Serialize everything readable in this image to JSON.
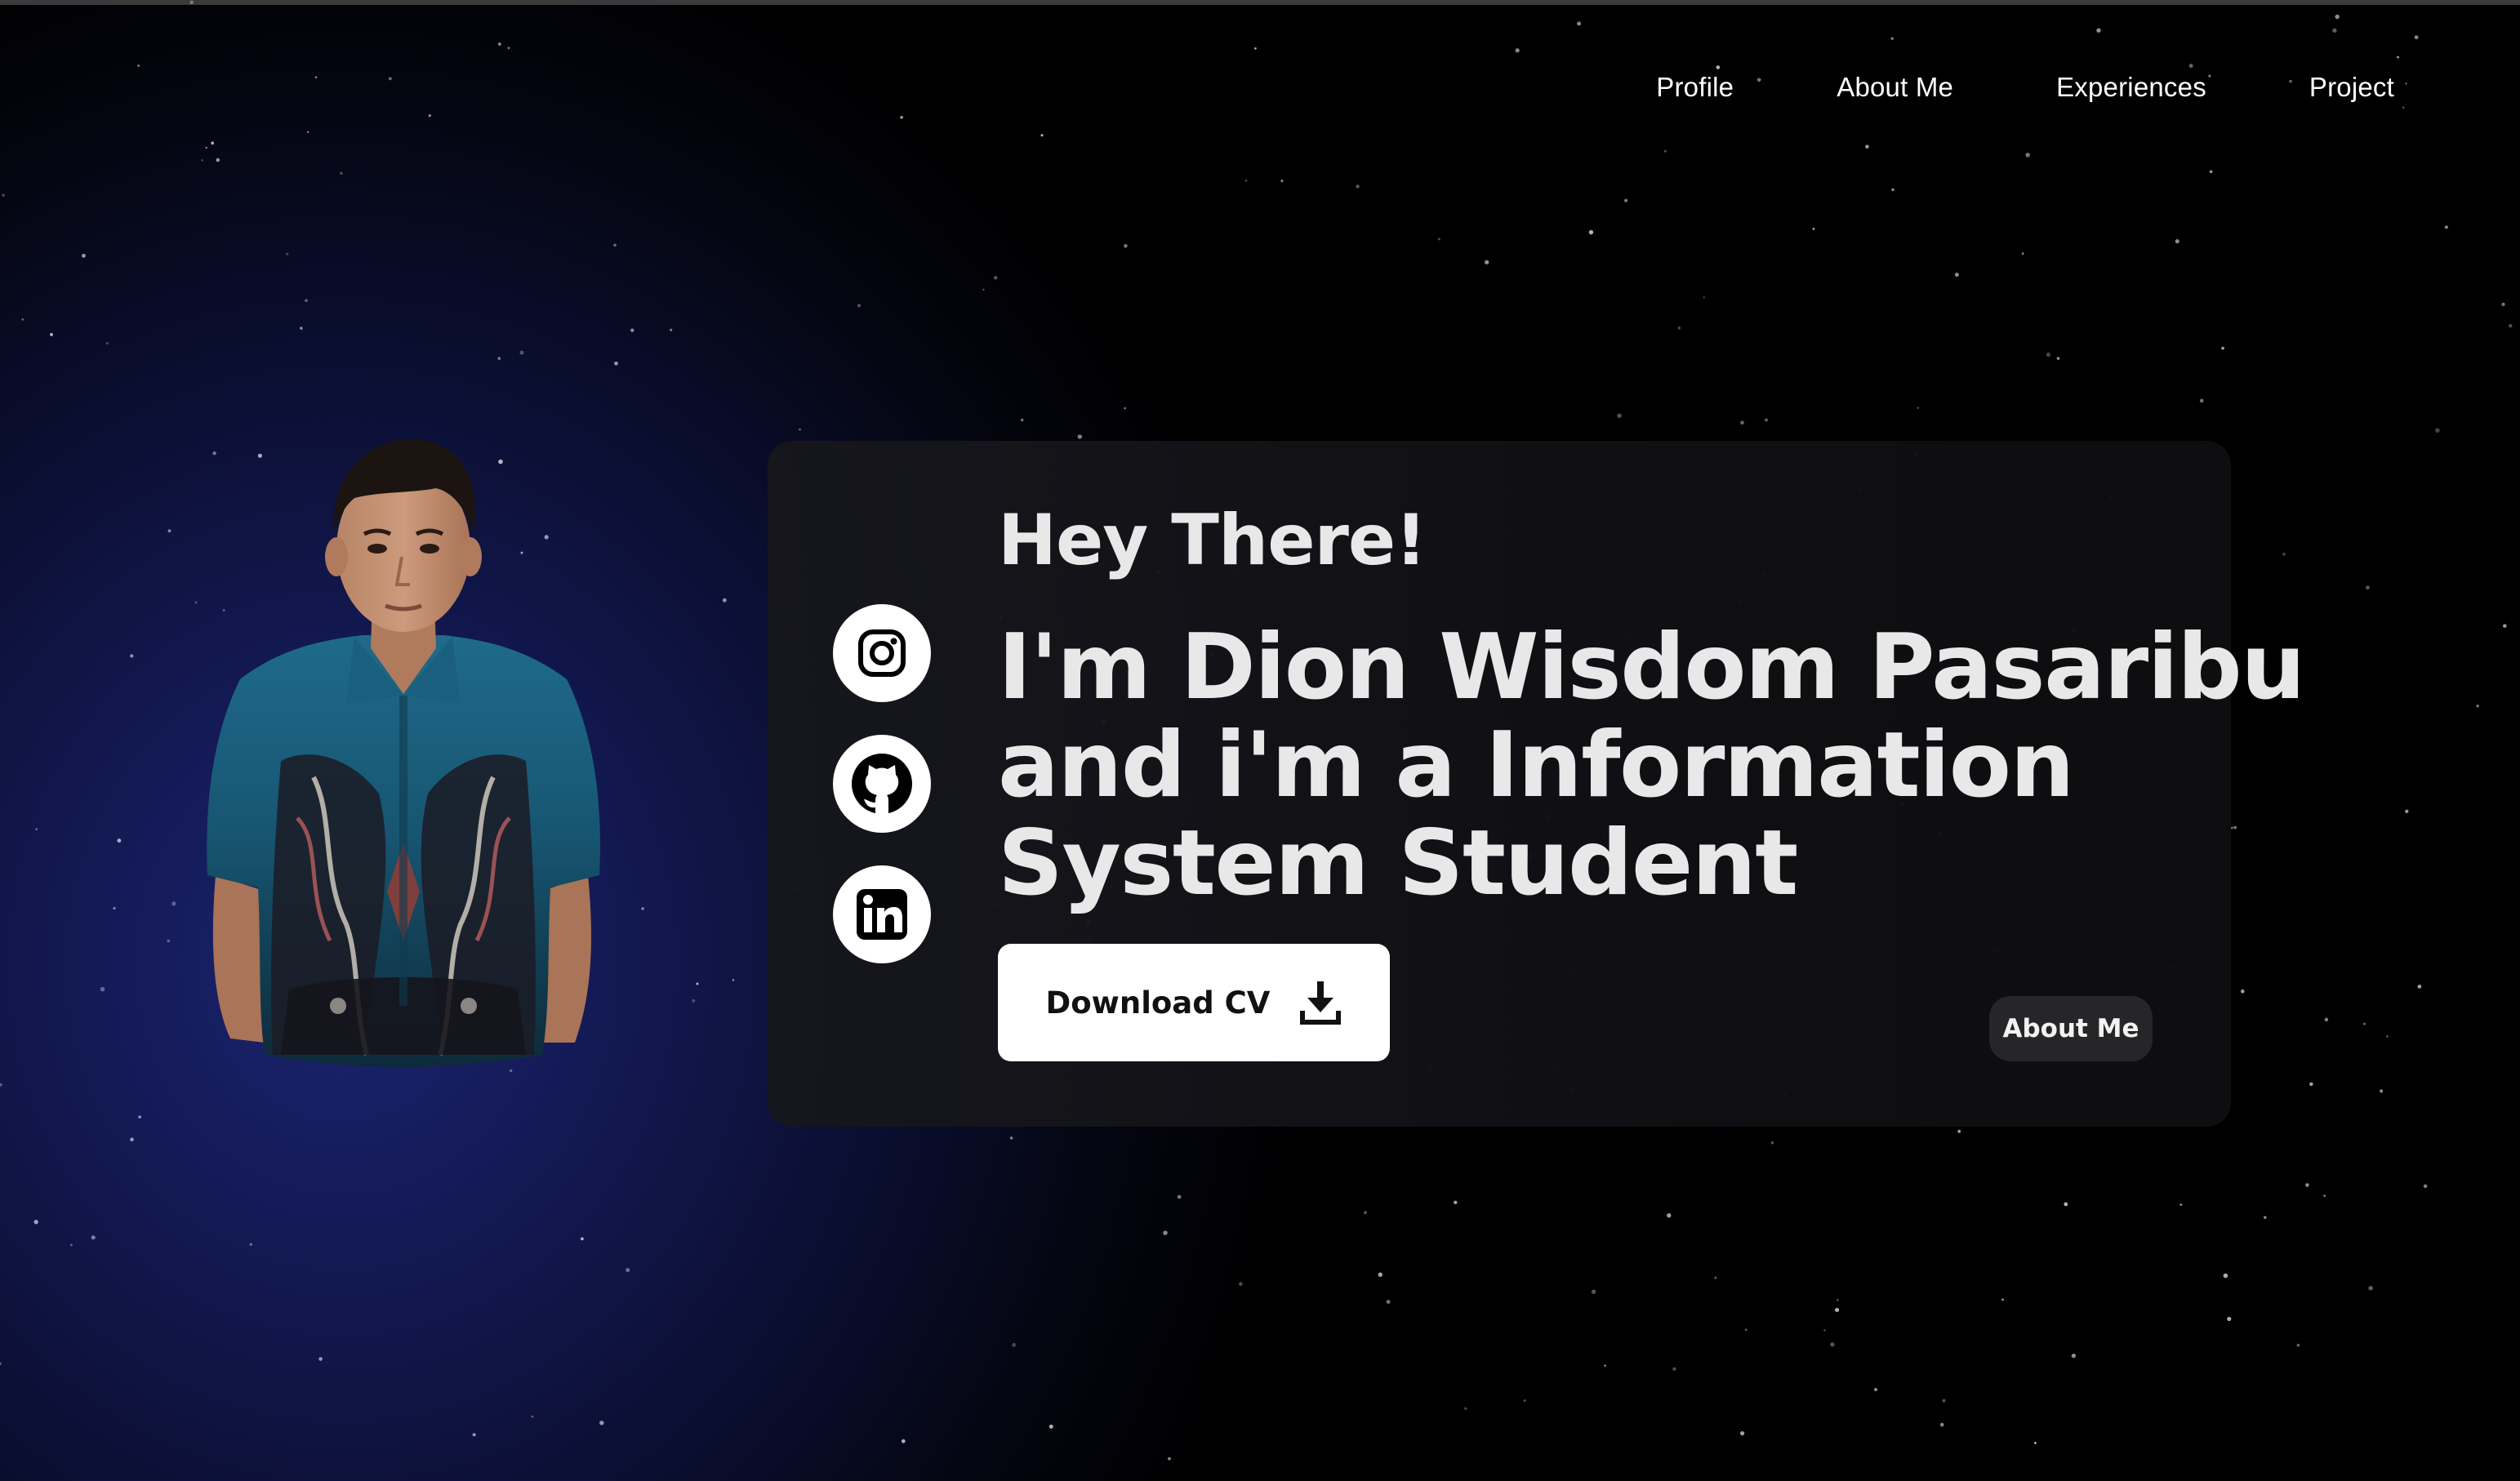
{
  "nav": {
    "items": [
      {
        "label": "Profile"
      },
      {
        "label": "About Me"
      },
      {
        "label": "Experiences"
      },
      {
        "label": "Project"
      }
    ]
  },
  "hero": {
    "greeting": "Hey There!",
    "headline_lines": [
      "I'm Dion Wisdom Pasaribu",
      "and i'm a Information",
      "System Student"
    ],
    "download_label": "Download CV",
    "about_label": "About Me"
  },
  "socials": [
    {
      "icon": "instagram-icon"
    },
    {
      "icon": "github-icon"
    },
    {
      "icon": "linkedin-icon"
    }
  ],
  "colors": {
    "background": "#000000",
    "glow": "#1b2470",
    "card": "#141418",
    "text": "#e8e8e8",
    "button": "#ffffff",
    "secondary_button": "#262628"
  }
}
